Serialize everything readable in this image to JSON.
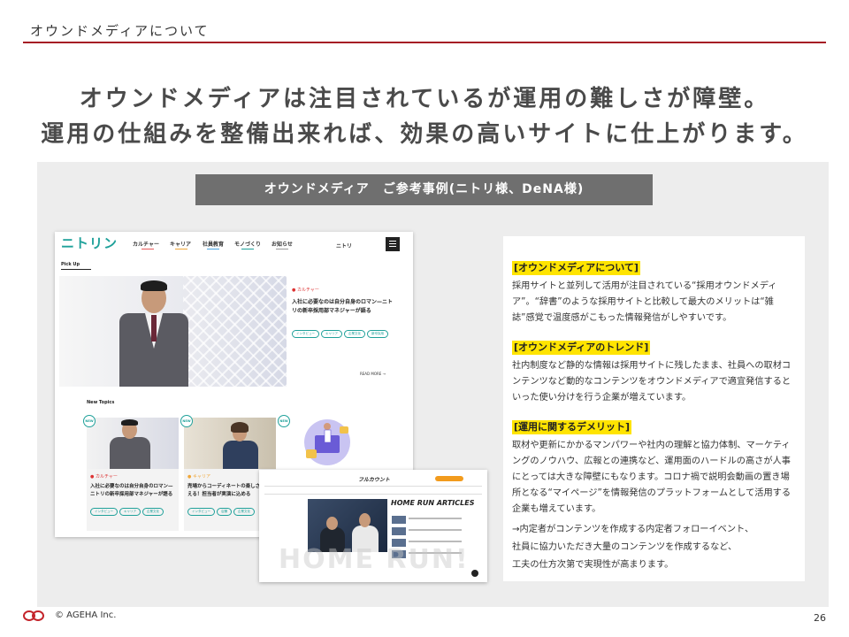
{
  "header": {
    "title": "オウンドメディアについて"
  },
  "headline": {
    "line1": "オウンドメディアは注目されているが運用の難しさが障壁。",
    "line2": "運用の仕組みを整備出来れば、効果の高いサイトに仕上がります。"
  },
  "panel": {
    "title": "オウンドメディア　ご参考事例(ニトリ様、DeNA様)"
  },
  "nitori": {
    "logo": "ニトリン",
    "nav": [
      {
        "label": "カルチャー",
        "color": "#e85b5b"
      },
      {
        "label": "キャリア",
        "color": "#f0a73a"
      },
      {
        "label": "社員教育",
        "color": "#4aa3df"
      },
      {
        "label": "モノづくり",
        "color": "#1fa19a"
      },
      {
        "label": "お知らせ",
        "color": "#999999"
      }
    ],
    "nav_right": "ニトリ",
    "pickup": "Pick Up",
    "hero_category": "カルチャー",
    "hero_headline": "入社に必要なのは自分自身のロマン—ニトリの新卒採用部マネジャーが語る",
    "hero_tags": [
      "インタビュー",
      "キャリア",
      "企業文化",
      "新卒採用"
    ],
    "read_more": "READ MORE",
    "new_topics": "New Topics",
    "new_badge": "NEW",
    "cards": [
      {
        "category": "カルチャー",
        "title": "入社に必要なのは自分自身のロマン—ニトリの新卒採用部マネジャーが語る",
        "tags": [
          "インタビュー",
          "キャリア",
          "企業文化"
        ]
      },
      {
        "category": "キャリア",
        "title": "売場からコーディネートの楽しさを伝える！担当者が実演に込める",
        "tags": [
          "インタビュー",
          "店舗",
          "企業文化"
        ]
      }
    ]
  },
  "homerun": {
    "logo": "フルカウント",
    "articles_title": "HOME RUN ARTICLES",
    "watermark": "HOME RUN!"
  },
  "sections": [
    {
      "heading": "[オウンドメディアについて]",
      "body": "採用サイトと並列して活用が注目されている“採用オウンドメディア”。“辞書”のような採用サイトと比較して最大のメリットは“雑誌”感覚で温度感がこもった情報発信がしやすいです。"
    },
    {
      "heading": "[オウンドメディアのトレンド]",
      "body": "社内制度など静的な情報は採用サイトに残したまま、社員への取材コンテンツなど動的なコンテンツをオウンドメディアで適宜発信するといった使い分けを行う企業が増えています。"
    },
    {
      "heading": "[運用に関するデメリット]",
      "body": "取材や更新にかかるマンパワーや社内の理解と協力体制、マーケティングのノウハウ、広報との連携など、運用面のハードルの高さが人事にとっては大きな障壁にもなります。コロナ禍で説明会動画の置き場所となる“マイページ”を情報発信のプラットフォームとして活用する企業も増えています。"
    }
  ],
  "closing": [
    "→内定者がコンテンツを作成する内定者フォローイベント、",
    "社員に協力いただき大量のコンテンツを作成するなど、",
    "工夫の仕方次第で実現性が高まります。"
  ],
  "footer": {
    "copyright": "© AGEHA Inc.",
    "page": "26"
  },
  "colors": {
    "accent": "#a61d24",
    "highlight": "#ffe400",
    "nitori": "#1fa19a"
  }
}
